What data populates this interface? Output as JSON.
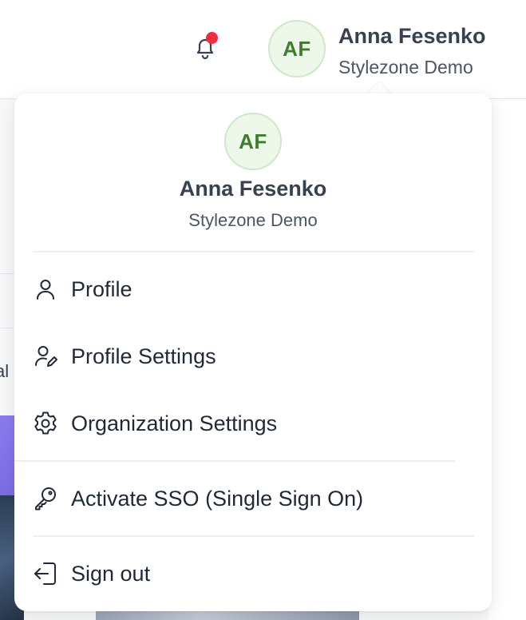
{
  "header": {
    "user_name": "Anna Fesenko",
    "organization": "Stylezone Demo",
    "avatar_initials": "AF",
    "notification_indicator_color": "#ef2f3c"
  },
  "background": {
    "partial_label": "al"
  },
  "dropdown": {
    "avatar_initials": "AF",
    "user_name": "Anna Fesenko",
    "organization": "Stylezone Demo",
    "menu": [
      {
        "label": "Profile",
        "icon": "user-icon"
      },
      {
        "label": "Profile Settings",
        "icon": "user-edit-icon"
      },
      {
        "label": "Organization Settings",
        "icon": "gear-icon"
      },
      {
        "label": "Activate SSO (Single Sign On)",
        "icon": "key-icon"
      },
      {
        "label": "Sign out",
        "icon": "sign-out-icon"
      }
    ]
  },
  "colors": {
    "avatar_bg": "#eef8ea",
    "avatar_text": "#3e7d2d",
    "text_primary": "#1f2937"
  }
}
